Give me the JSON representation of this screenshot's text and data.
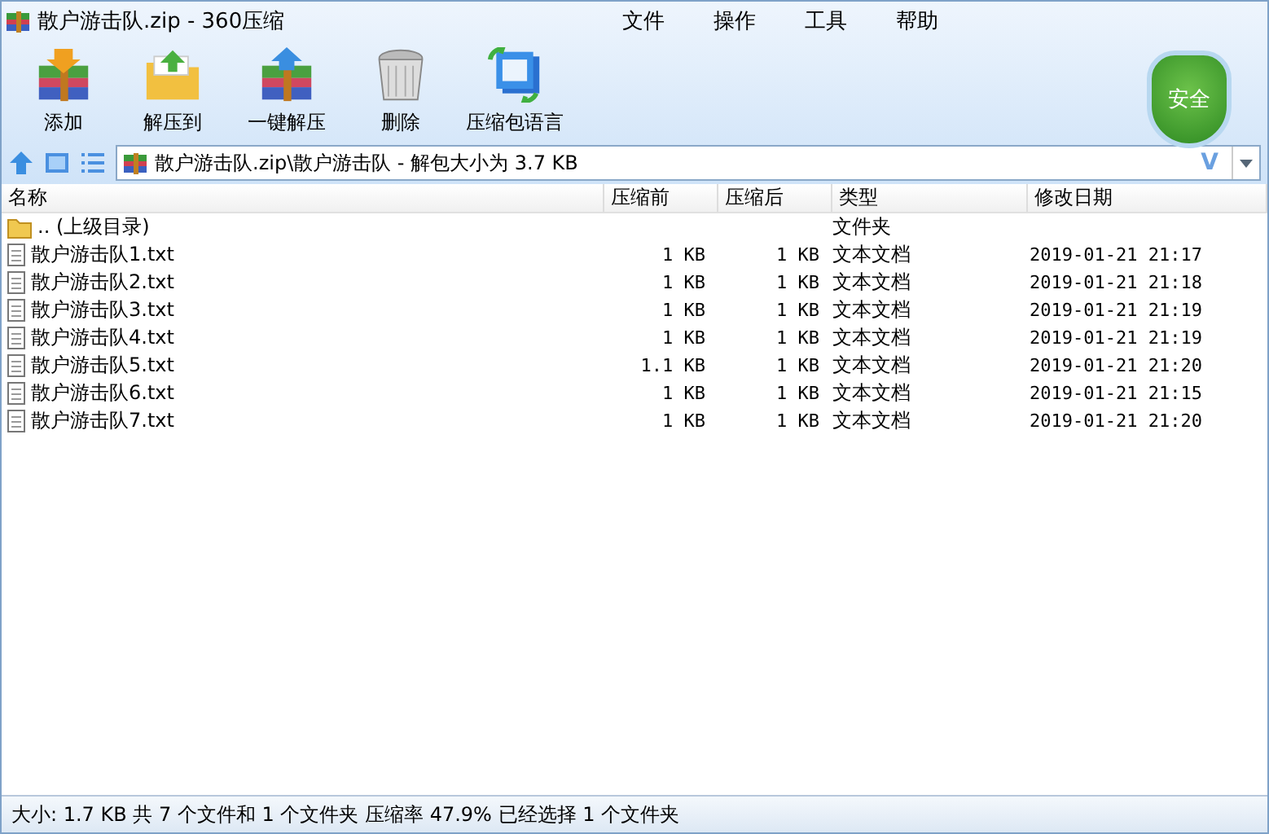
{
  "window": {
    "title": "散户游击队.zip - 360压缩"
  },
  "menu": [
    "文件",
    "操作",
    "工具",
    "帮助"
  ],
  "toolbar": [
    {
      "label": "添加",
      "kind": "add"
    },
    {
      "label": "解压到",
      "kind": "extract-to"
    },
    {
      "label": "一键解压",
      "kind": "extract"
    },
    {
      "label": "删除",
      "kind": "delete"
    },
    {
      "label": "压缩包语言",
      "kind": "language"
    }
  ],
  "safety_badge": "安全",
  "address": {
    "path": "散户游击队.zip\\散户游击队 - 解包大小为 3.7 KB",
    "verify_mark": "V"
  },
  "table": {
    "columns": [
      "名称",
      "压缩前",
      "压缩后",
      "类型",
      "修改日期"
    ],
    "rows": [
      {
        "kind": "folder",
        "name": ".. (上级目录)",
        "type": "文件夹"
      },
      {
        "kind": "file",
        "name": "散户游击队1.txt",
        "size_before": "1 KB",
        "size_after": "1 KB",
        "type": "文本文档",
        "modified": "2019-01-21 21:17"
      },
      {
        "kind": "file",
        "name": "散户游击队2.txt",
        "size_before": "1 KB",
        "size_after": "1 KB",
        "type": "文本文档",
        "modified": "2019-01-21 21:18"
      },
      {
        "kind": "file",
        "name": "散户游击队3.txt",
        "size_before": "1 KB",
        "size_after": "1 KB",
        "type": "文本文档",
        "modified": "2019-01-21 21:19"
      },
      {
        "kind": "file",
        "name": "散户游击队4.txt",
        "size_before": "1 KB",
        "size_after": "1 KB",
        "type": "文本文档",
        "modified": "2019-01-21 21:19"
      },
      {
        "kind": "file",
        "name": "散户游击队5.txt",
        "size_before": "1.1 KB",
        "size_after": "1 KB",
        "type": "文本文档",
        "modified": "2019-01-21 21:20"
      },
      {
        "kind": "file",
        "name": "散户游击队6.txt",
        "size_before": "1 KB",
        "size_after": "1 KB",
        "type": "文本文档",
        "modified": "2019-01-21 21:15"
      },
      {
        "kind": "file",
        "name": "散户游击队7.txt",
        "size_before": "1 KB",
        "size_after": "1 KB",
        "type": "文本文档",
        "modified": "2019-01-21 21:20"
      }
    ]
  },
  "status_bar": "大小: 1.7 KB 共 7 个文件和 1 个文件夹 压缩率 47.9% 已经选择 1 个文件夹"
}
